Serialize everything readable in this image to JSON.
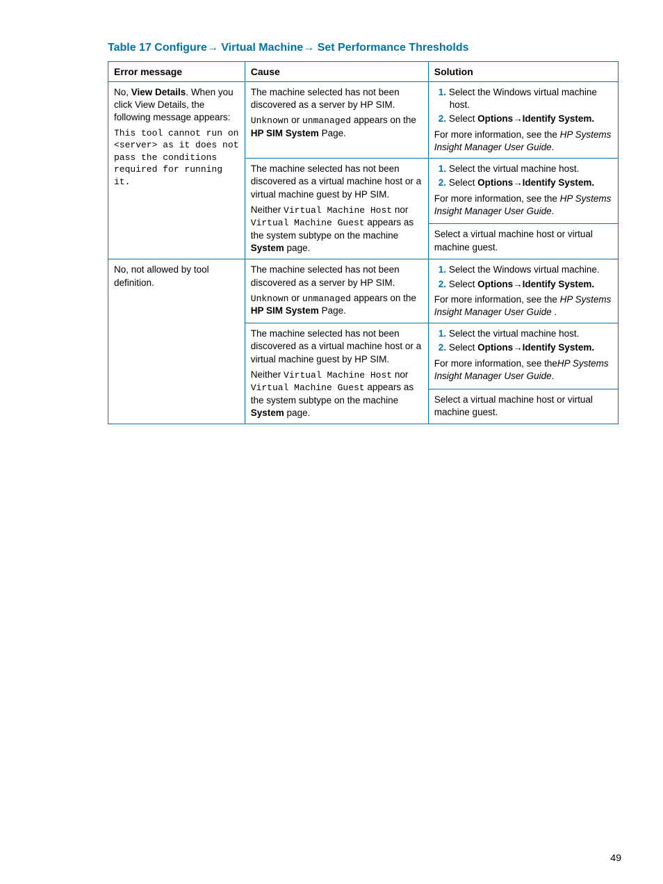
{
  "title_prefix": "Table 17  Configure",
  "title_mid1": " Virtual Machine",
  "title_mid2": " Set Performance Thresholds",
  "arrow": "→",
  "headers": {
    "error": "Error message",
    "cause": "Cause",
    "solution": "Solution"
  },
  "row1": {
    "error_p1a": "No, ",
    "error_p1b": "View Details",
    "error_p1c": ". When you click View Details, the following message appears:",
    "error_code": "This tool cannot run on <server> as it does not pass the conditions required for running it.",
    "cause1_p1": "The machine selected has not been discovered as a server by HP SIM.",
    "cause1_p2a": "Unknown",
    "cause1_p2b": " or ",
    "cause1_p2c": "unmanaged",
    "cause1_p2d": " appears on the ",
    "cause1_p2e": "HP SIM System",
    "cause1_p2f": " Page.",
    "sol1_li1": "Select the Windows virtual machine host.",
    "sol1_li2a": "Select ",
    "sol1_li2b": "Options",
    "sol1_li2c": "Identify System.",
    "sol1_more1": "For more information, see the ",
    "sol1_more2": "HP Systems Insight Manager User Guide",
    "sol1_more3": ".",
    "cause2_p1": "The machine selected has not been discovered as a virtual machine host or a virtual machine guest by HP SIM.",
    "cause2_p2a": "Neither ",
    "cause2_p2b": "Virtual Machine Host",
    "cause2_p2c": " nor ",
    "cause2_p2d": "Virtual Machine Guest",
    "cause2_p2e": " appears as the system subtype on the machine ",
    "cause2_p2f": "System",
    "cause2_p2g": " page.",
    "sol2_li1": "Select the virtual machine host.",
    "sol2_li2a": "Select ",
    "sol2_li2b": "Options",
    "sol2_li2c": "Identify System.",
    "sol2_more1": "For more information, see the ",
    "sol2_more2": "HP Systems Insight Manager User Guide",
    "sol2_more3": ".",
    "sol3": "Select a virtual machine host or virtual machine guest."
  },
  "row2": {
    "error": "No, not allowed by tool definition.",
    "cause1_p1": "The machine selected has not been discovered as a server by HP SIM.",
    "cause1_p2a": "Unknown",
    "cause1_p2b": " or ",
    "cause1_p2c": "unmanaged",
    "cause1_p2d": " appears on the ",
    "cause1_p2e": "HP SIM System",
    "cause1_p2f": "  Page.",
    "sol1_li1": "Select the Windows virtual machine.",
    "sol1_li2a": "Select ",
    "sol1_li2b": "Options",
    "sol1_li2c": "Identify System.",
    "sol1_more1": "For more information, see the ",
    "sol1_more2": "HP Systems Insight Manager User Guide ",
    "sol1_more3": ".",
    "cause2_p1": "The machine selected has not been discovered as a virtual machine host or a virtual machine guest by HP SIM.",
    "cause2_p2a": "Neither ",
    "cause2_p2b": "Virtual Machine Host",
    "cause2_p2c": " nor ",
    "cause2_p2d": "Virtual Machine Guest",
    "cause2_p2e": " appears as the system subtype on the machine ",
    "cause2_p2f": "System",
    "cause2_p2g": " page.",
    "sol2_li1": "Select the virtual machine host.",
    "sol2_li2a": "Select ",
    "sol2_li2b": "Options",
    "sol2_li2c": "Identify System.",
    "sol2_more1": "For more information, see the",
    "sol2_more2": "HP Systems Insight Manager User Guide",
    "sol2_more3": ".",
    "sol3": "Select a virtual machine host or virtual machine guest."
  },
  "page_number": "49",
  "num1": "1.",
  "num2": "2."
}
